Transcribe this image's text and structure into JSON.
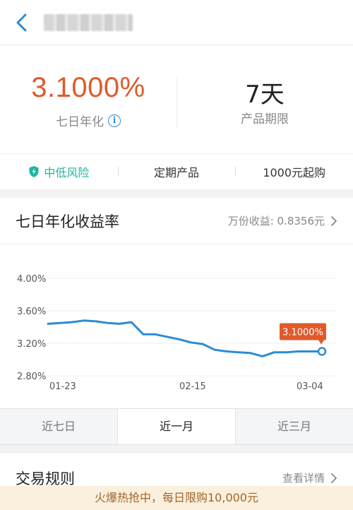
{
  "nav": {
    "title": "■■■■■■"
  },
  "summary": {
    "rate_value": "3.1000%",
    "rate_label": "七日年化",
    "term_value": "7天",
    "term_label": "产品期限"
  },
  "tags": [
    {
      "label": "中低风险",
      "icon": "shield-icon"
    },
    {
      "label": "定期产品"
    },
    {
      "label": "1000元起购"
    }
  ],
  "chart_section": {
    "title": "七日年化收益率",
    "link_label": "万份收益: 0.8356元"
  },
  "chart_data": {
    "type": "line",
    "title": "七日年化收益率",
    "xlabel": "",
    "ylabel": "",
    "ylim": [
      2.8,
      4.0
    ],
    "y_ticks": [
      "4.00%",
      "3.60%",
      "3.20%",
      "2.80%"
    ],
    "x_ticks": [
      "01-23",
      "02-15",
      "03-04"
    ],
    "grid": "horizontal",
    "line_color": "#2b8bd6",
    "highlight_color": "#e05a2b",
    "highlight_label": "3.1000%",
    "series": [
      {
        "values": [
          3.44,
          3.45,
          3.46,
          3.48,
          3.47,
          3.45,
          3.44,
          3.46,
          3.31,
          3.31,
          3.28,
          3.25,
          3.21,
          3.19,
          3.12,
          3.1,
          3.09,
          3.08,
          3.04,
          3.09,
          3.09,
          3.1,
          3.1,
          3.1
        ]
      }
    ]
  },
  "period_tabs": [
    {
      "label": "近七日",
      "active": false
    },
    {
      "label": "近一月",
      "active": true
    },
    {
      "label": "近三月",
      "active": false
    }
  ],
  "rules": {
    "title": "交易规则",
    "link_label": "查看详情"
  },
  "banner": {
    "text": "火爆热抢中，每日限购10,000元"
  }
}
